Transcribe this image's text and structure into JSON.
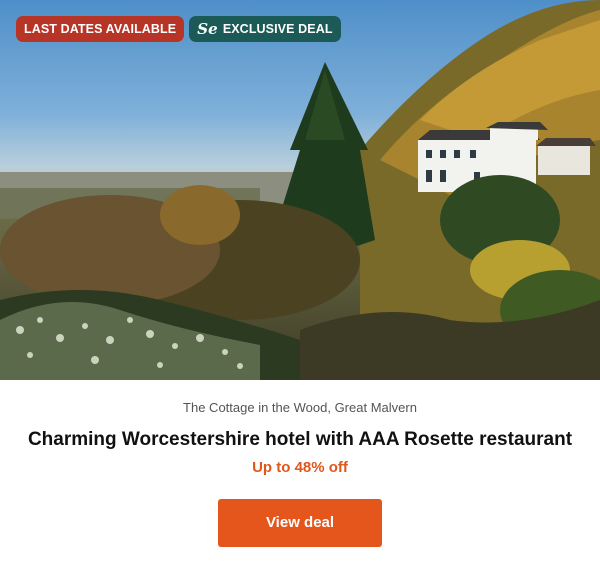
{
  "badges": {
    "last_dates": "LAST DATES AVAILABLE",
    "exclusive": "EXCLUSIVE DEAL",
    "exclusive_logo": "Se"
  },
  "hero_image": {
    "alt_icon": "hotel-landscape-photo"
  },
  "deal": {
    "location": "The Cottage in the Wood, Great Malvern",
    "title": "Charming Worcestershire hotel with AAA Rosette restaurant",
    "discount": "Up to 48% off",
    "cta": "View deal"
  },
  "colors": {
    "badge_red": "#b73526",
    "badge_teal": "#1b5a57",
    "accent_orange": "#e5561c"
  }
}
